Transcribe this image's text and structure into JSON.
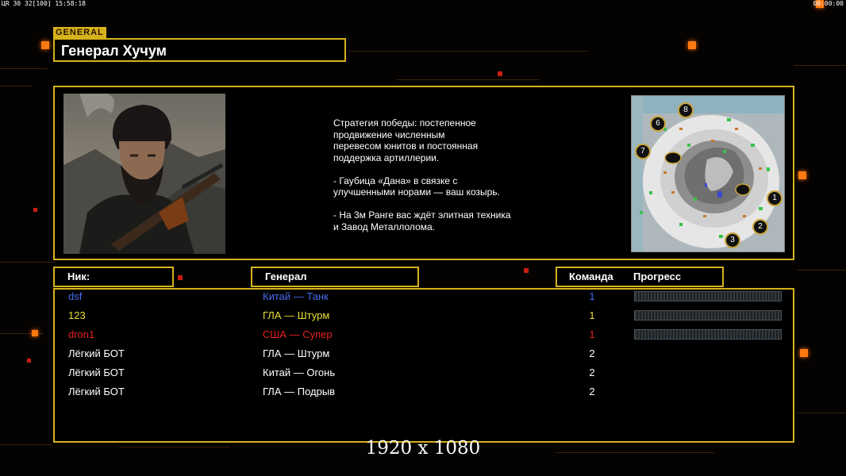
{
  "topbar": {
    "left": "ЦR 30 32[100] 15:58:18",
    "right": "00:00:00"
  },
  "general": {
    "tag": "GENERAL",
    "name": "Генерал Хучум"
  },
  "description": "Стратегия победы: постепенное\nпродвижение численным\nперевесом юнитов и постоянная\nподдержка артиллерии.\n\n- Гаубица «Дана» в связке с\nулучшенными норами — ваш козырь.\n\n- На 3м Ранге вас ждёт элитная техника\nи Завод Металлолома.",
  "headers": {
    "nick": "Ник:",
    "general": "Генерал",
    "team": "Команда",
    "progress": "Прогресс"
  },
  "players": [
    {
      "nick": "dsf",
      "general": "Китай — Танк",
      "team": "1",
      "color": "#4a6cf0",
      "progress": true
    },
    {
      "nick": "123",
      "general": "ГЛА — Штурм",
      "team": "1",
      "color": "#e8e030",
      "progress": true
    },
    {
      "nick": "dron1",
      "general": "США — Супер",
      "team": "1",
      "color": "#e82020",
      "progress": true
    },
    {
      "nick": "Лёгкий БОТ",
      "general": "ГЛА — Штурм",
      "team": "2",
      "color": "#ffffff",
      "progress": false
    },
    {
      "nick": "Лёгкий БОТ",
      "general": "Китай — Огонь",
      "team": "2",
      "color": "#ffffff",
      "progress": false
    },
    {
      "nick": "Лёгкий БОТ",
      "general": "ГЛА — Подрыв",
      "team": "2",
      "color": "#ffffff",
      "progress": false
    }
  ],
  "map": {
    "start_positions": [
      "1",
      "2",
      "3",
      "6",
      "7",
      "8"
    ]
  },
  "resolution": "1920 x 1080",
  "colors": {
    "frame": "#d6b21c",
    "accent": "#ff7a10"
  }
}
